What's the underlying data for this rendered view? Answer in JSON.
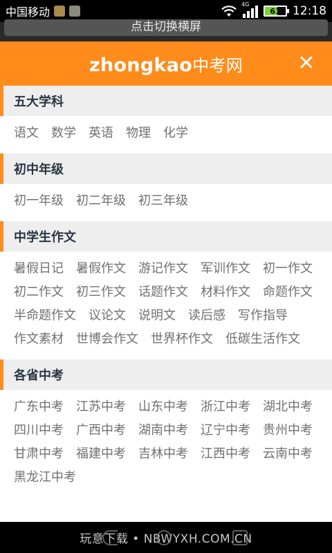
{
  "status": {
    "carrier": "中国移动",
    "network": "4G",
    "battery": "61",
    "battery_level": 0.61,
    "time": "12:18"
  },
  "banner": {
    "text": "点击切换横屏"
  },
  "header": {
    "logo_en": "zhongkao",
    "logo_cn": "中考网",
    "close_label": "✕"
  },
  "sections": [
    {
      "title": "五大学科",
      "items": [
        "语文",
        "数学",
        "英语",
        "物理",
        "化学"
      ]
    },
    {
      "title": "初中年级",
      "items": [
        "初一年级",
        "初二年级",
        "初三年级"
      ]
    },
    {
      "title": "中学生作文",
      "items": [
        "暑假日记",
        "暑假作文",
        "游记作文",
        "军训作文",
        "初一作文",
        "初二作文",
        "初三作文",
        "话题作文",
        "材料作文",
        "命题作文",
        "半命题作文",
        "议论文",
        "说明文",
        "读后感",
        "写作指导",
        "作文素材",
        "世博会作文",
        "世界杯作文",
        "低碳生活作文"
      ]
    },
    {
      "title": "各省中考",
      "items": [
        "广东中考",
        "江苏中考",
        "山东中考",
        "浙江中考",
        "湖北中考",
        "四川中考",
        "广西中考",
        "湖南中考",
        "辽宁中考",
        "贵州中考",
        "甘肃中考",
        "福建中考",
        "吉林中考",
        "江西中考",
        "云南中考",
        "黑龙江中考"
      ]
    }
  ],
  "footer": {
    "watermark": "玩意下载 • NBWYXH.COM.CN"
  },
  "colors": {
    "accent": "#ff8b1a",
    "section_bg": "#eeeeee",
    "link": "#707070"
  }
}
